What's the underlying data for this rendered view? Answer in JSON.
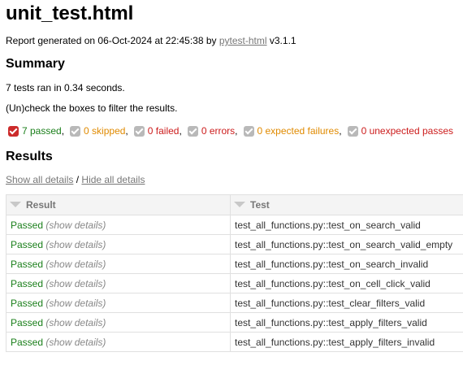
{
  "title": "unit_test.html",
  "generated": {
    "prefix": "Report generated on 06-Oct-2024 at 22:45:38 by ",
    "link": "pytest-html",
    "suffix": " v3.1.1"
  },
  "summary": {
    "heading": "Summary",
    "ran": "7 tests ran in 0.34 seconds.",
    "instructions": "(Un)check the boxes to filter the results."
  },
  "filters": [
    {
      "label": "7 passed",
      "sep": ",",
      "checked": true
    },
    {
      "label": "0 skipped",
      "sep": ",",
      "checked": true
    },
    {
      "label": "0 failed",
      "sep": ",",
      "checked": true
    },
    {
      "label": "0 errors",
      "sep": ",",
      "checked": true
    },
    {
      "label": "0 expected failures",
      "sep": ",",
      "checked": true
    },
    {
      "label": "0 unexpected passes",
      "sep": "",
      "checked": true
    }
  ],
  "results": {
    "heading": "Results",
    "show_all": "Show all details",
    "separator": " / ",
    "hide_all": "Hide all details",
    "columns": [
      "Result",
      "Test"
    ],
    "rows": [
      {
        "result": "Passed",
        "details": "(show details)",
        "test": "test_all_functions.py::test_on_search_valid"
      },
      {
        "result": "Passed",
        "details": "(show details)",
        "test": "test_all_functions.py::test_on_search_valid_empty"
      },
      {
        "result": "Passed",
        "details": "(show details)",
        "test": "test_all_functions.py::test_on_search_invalid"
      },
      {
        "result": "Passed",
        "details": "(show details)",
        "test": "test_all_functions.py::test_on_cell_click_valid"
      },
      {
        "result": "Passed",
        "details": "(show details)",
        "test": "test_all_functions.py::test_clear_filters_valid"
      },
      {
        "result": "Passed",
        "details": "(show details)",
        "test": "test_all_functions.py::test_apply_filters_valid"
      },
      {
        "result": "Passed",
        "details": "(show details)",
        "test": "test_all_functions.py::test_apply_filters_invalid"
      }
    ]
  },
  "colors": {
    "passed": "#1a7f1a",
    "skipped": "#e08a00",
    "failed": "#cc1c1c",
    "checkbox_on": "#cc2b2b",
    "checkbox_off": "#b9b9b9"
  }
}
